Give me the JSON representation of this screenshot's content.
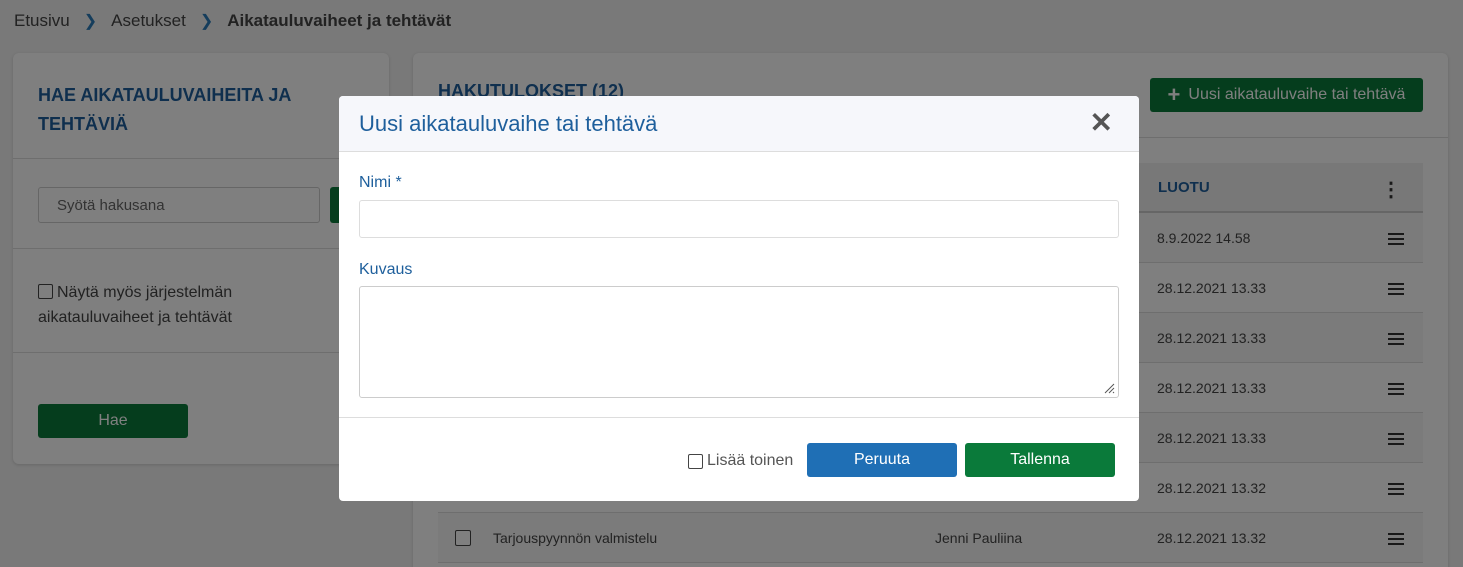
{
  "breadcrumb": {
    "items": [
      "Etusivu",
      "Asetukset",
      "Aikatauluvaiheet ja tehtävät"
    ]
  },
  "search_panel": {
    "title": "HAE AIKATAULUVAIHEITA JA TEHTÄVIÄ",
    "search_placeholder": "Syötä hakusana",
    "show_system_label": "Näytä myös järjestelmän aikatauluvaiheet ja tehtävät",
    "search_button": "Hae"
  },
  "results_panel": {
    "title": "HAKUTULOKSET (12)",
    "new_button": "Uusi aikatauluvaihe tai tehtävä",
    "columns": {
      "created": "LUOTU"
    },
    "rows": [
      {
        "name": "",
        "creator": "",
        "created": "8.9.2022 14.58"
      },
      {
        "name": "",
        "creator": "",
        "created": "28.12.2021 13.33"
      },
      {
        "name": "",
        "creator": "",
        "created": "28.12.2021 13.33"
      },
      {
        "name": "",
        "creator": "",
        "created": "28.12.2021 13.33"
      },
      {
        "name": "",
        "creator": "",
        "created": "28.12.2021 13.33"
      },
      {
        "name": "",
        "creator": "",
        "created": "28.12.2021 13.32"
      },
      {
        "name": "Tarjouspyynnön valmistelu",
        "creator": "Jenni Pauliina",
        "created": "28.12.2021 13.32"
      }
    ]
  },
  "modal": {
    "title": "Uusi aikatauluvaihe tai tehtävä",
    "name_label": "Nimi *",
    "name_value": "",
    "description_label": "Kuvaus",
    "description_value": "",
    "add_another_label": "Lisää toinen",
    "cancel_button": "Peruuta",
    "save_button": "Tallenna"
  },
  "colors": {
    "primary_green": "#0a7a3a",
    "primary_blue": "#1f6fb5",
    "heading_blue": "#1e5f9c"
  }
}
